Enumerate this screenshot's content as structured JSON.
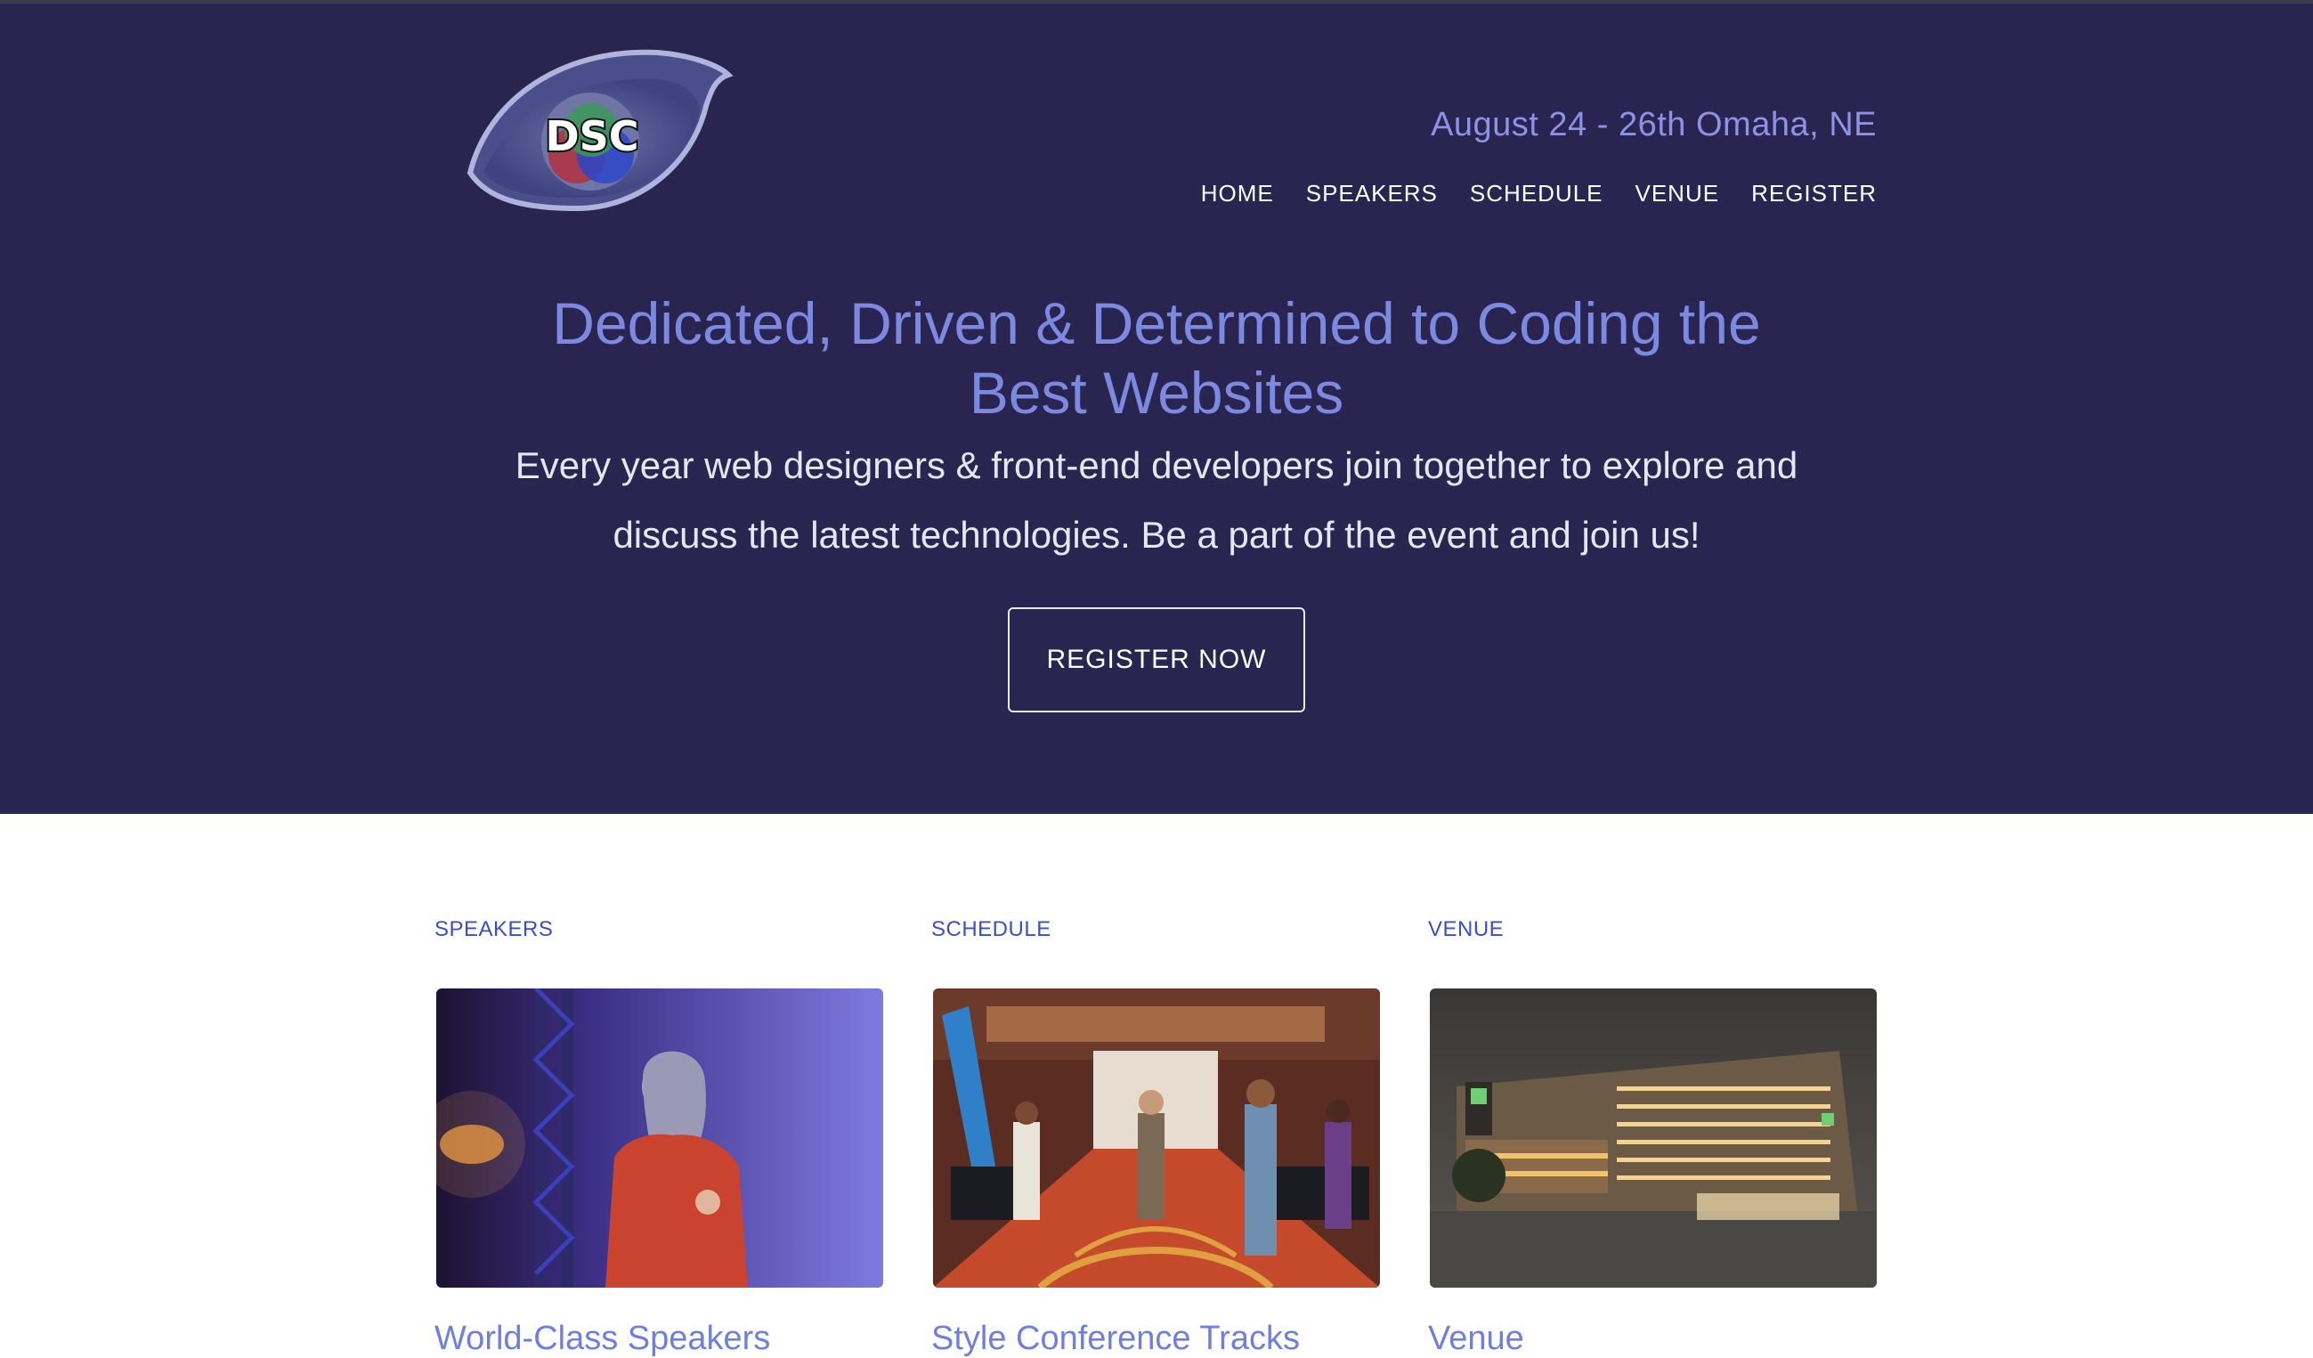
{
  "header": {
    "logo_text": "DSC",
    "date_location": "August 24 - 26th Omaha, NE",
    "nav": [
      {
        "label": "HOME"
      },
      {
        "label": "SPEAKERS"
      },
      {
        "label": "SCHEDULE"
      },
      {
        "label": "VENUE"
      },
      {
        "label": "REGISTER"
      }
    ]
  },
  "hero": {
    "headline": "Dedicated, Driven & Determined to Coding the Best Websites",
    "lede": "Every year web designers & front-end developers join together to explore and discuss the latest technologies. Be a part of the event and join us!",
    "cta_label": "REGISTER NOW"
  },
  "cards": [
    {
      "eyebrow": "SPEAKERS",
      "title": "World-Class Speakers",
      "image": "speaker-on-stage-photo"
    },
    {
      "eyebrow": "SCHEDULE",
      "title": "Style Conference Tracks",
      "image": "conference-hall-photo"
    },
    {
      "eyebrow": "VENUE",
      "title": "Venue",
      "image": "hotel-at-night-photo"
    }
  ],
  "colors": {
    "hero_bg": "#2a2451",
    "accent": "#7b8ae0",
    "eyebrow": "#3b4fc0"
  }
}
